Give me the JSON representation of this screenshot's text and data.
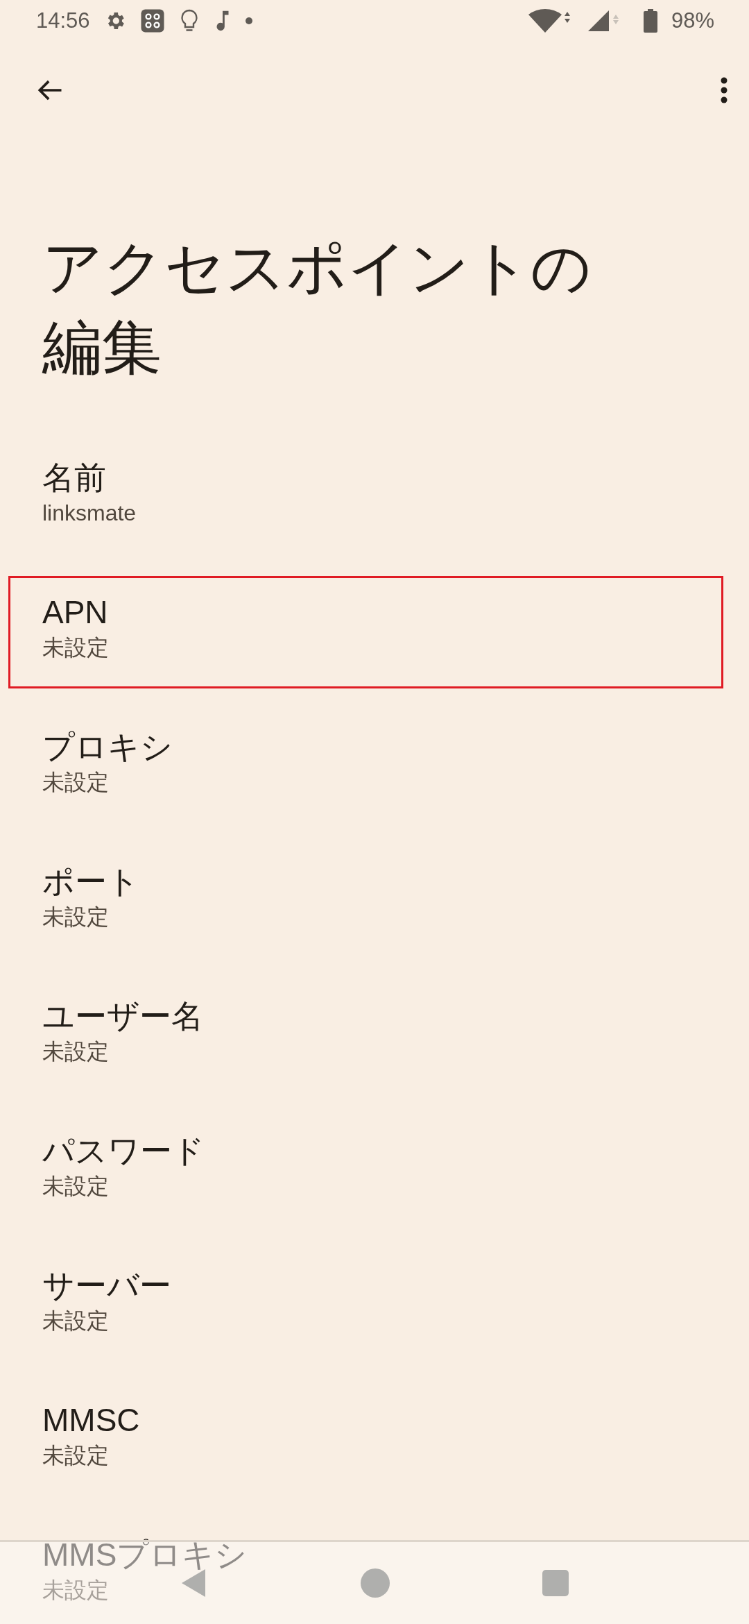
{
  "status_bar": {
    "time": "14:56",
    "battery": "98%"
  },
  "title": "アクセスポイントの編集",
  "items": [
    {
      "label": "名前",
      "value": "linksmate",
      "highlighted": false
    },
    {
      "label": "APN",
      "value": "未設定",
      "highlighted": true
    },
    {
      "label": "プロキシ",
      "value": "未設定",
      "highlighted": false
    },
    {
      "label": "ポート",
      "value": "未設定",
      "highlighted": false
    },
    {
      "label": "ユーザー名",
      "value": "未設定",
      "highlighted": false
    },
    {
      "label": "パスワード",
      "value": "未設定",
      "highlighted": false
    },
    {
      "label": "サーバー",
      "value": "未設定",
      "highlighted": false
    },
    {
      "label": "MMSC",
      "value": "未設定",
      "highlighted": false
    },
    {
      "label": "MMSプロキシ",
      "value": "未設定",
      "highlighted": false
    }
  ]
}
